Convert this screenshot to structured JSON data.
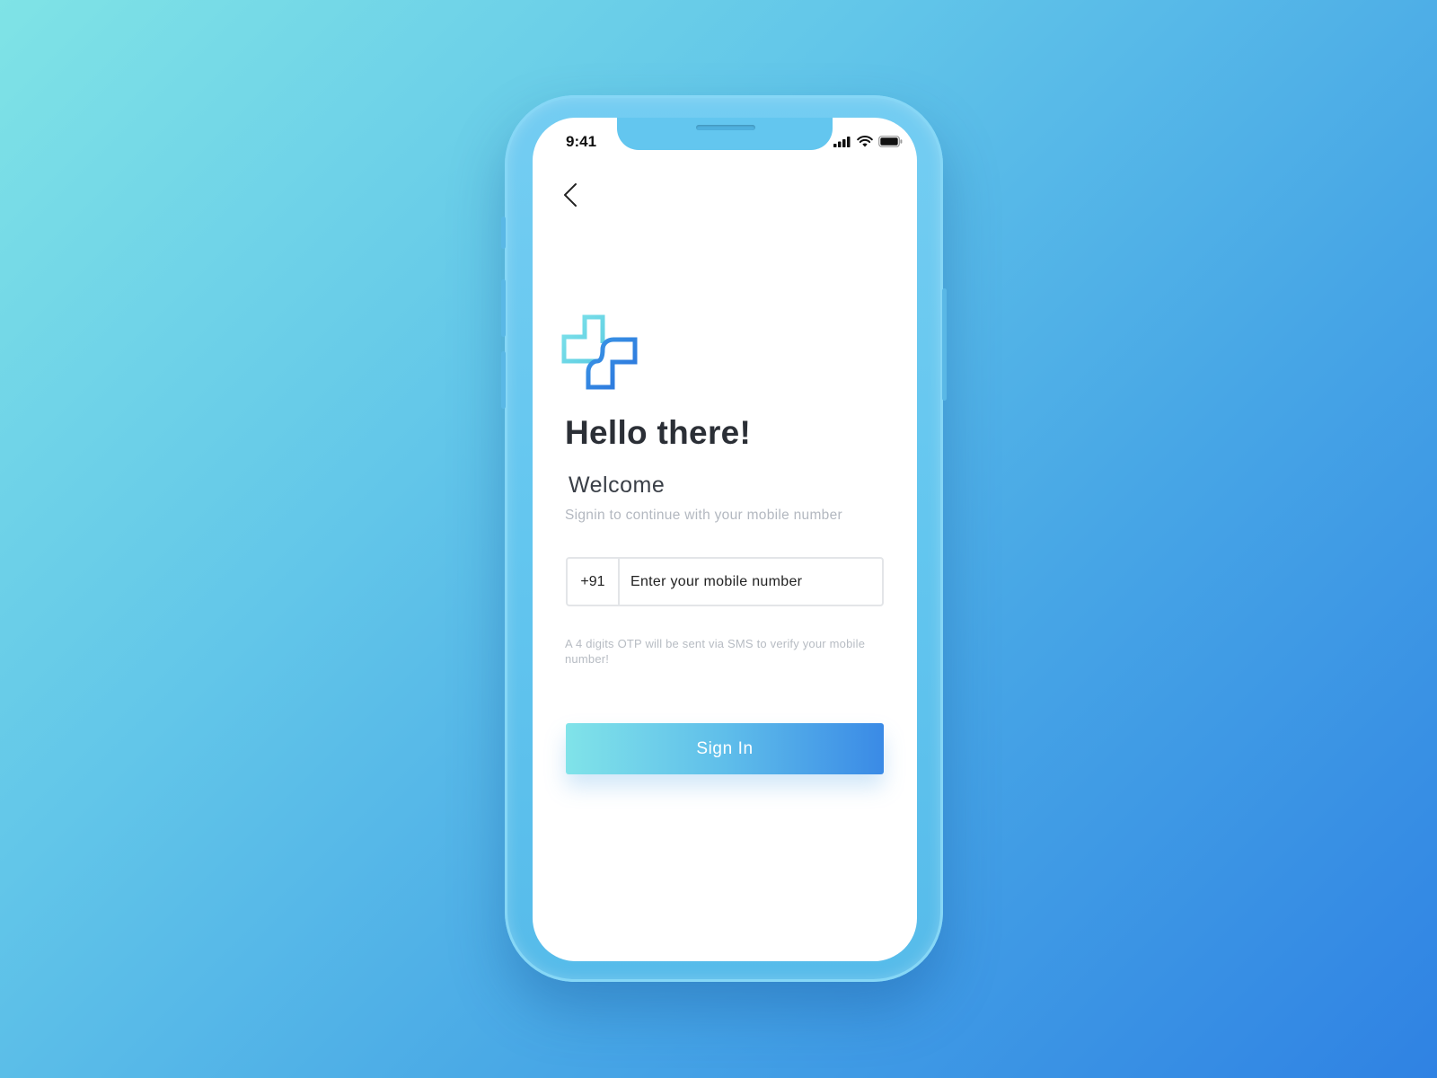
{
  "status_bar": {
    "time": "9:41",
    "icons": [
      "signal-icon",
      "wifi-icon",
      "battery-icon"
    ]
  },
  "nav": {
    "back_icon": "chevron-left-icon"
  },
  "logo": {
    "icon": "medical-cross-logo",
    "colors": [
      "#6fd8e6",
      "#2e7fe0"
    ]
  },
  "content": {
    "title": "Hello there!",
    "welcome": "Welcome",
    "subtitle": "Signin to continue with your mobile number"
  },
  "form": {
    "country_code": "+91",
    "phone_placeholder": "Enter your mobile number",
    "phone_value": "",
    "helper_text": "A 4 digits OTP will be sent via SMS to verify your mobile number!",
    "submit_label": "Sign In"
  },
  "colors": {
    "button_gradient_start": "#80e3e9",
    "button_gradient_end": "#3a8ae6",
    "title_color": "#2b2f36",
    "muted_text": "#b3b8c0"
  }
}
